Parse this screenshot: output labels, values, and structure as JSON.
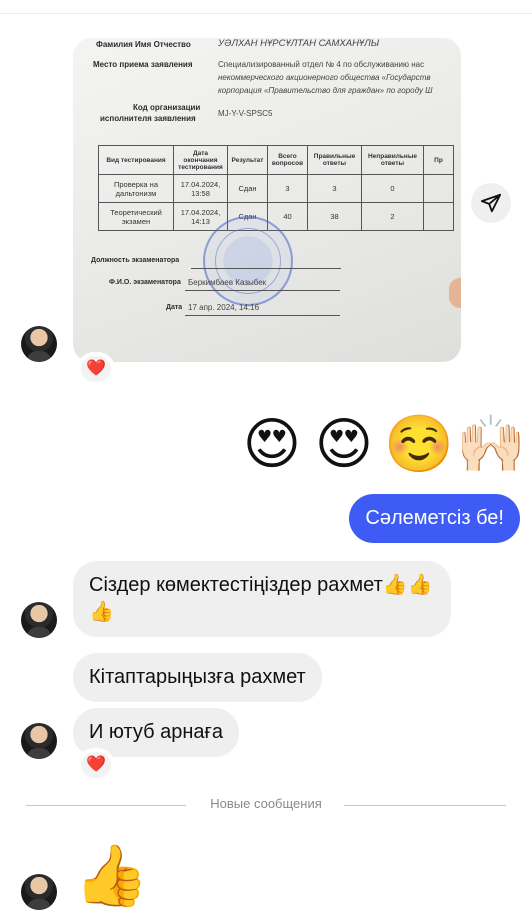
{
  "document_photo": {
    "fields": {
      "fio_label": "Фамилия Имя Отчество",
      "fio_value": "УӘЛХАН НҰРСҰЛТАН САМХАНҰЛЫ",
      "place_label": "Место приема заявления",
      "place_value_1": "Специализированный отдел № 4 по обслуживанию нас",
      "place_value_2": "некоммерческого акционерного общества «Государств",
      "place_value_3": "корпорация «Правительство для граждан» по городу Ш",
      "org_code_label_1": "Код организации",
      "org_code_label_2": "исполнителя заявления",
      "org_code_value": "MJ-Y-V-SPSC5",
      "examiner_title_label": "Должность экзаменатора",
      "examiner_name_label": "Ф.И.О. экзаменатора",
      "examiner_name_value": "Беркимбаев Казыбек",
      "date_label": "Дата",
      "date_value": "17 апр. 2024, 14:16"
    },
    "table": {
      "headers": [
        "Вид тестирования",
        "Дата окончания тестирования",
        "Результат",
        "Всего вопросов",
        "Правильные ответы",
        "Неправильные ответы",
        "Пр"
      ],
      "rows": [
        [
          "Проверка на дальтонизм",
          "17.04.2024, 13:58",
          "Сдан",
          "3",
          "3",
          "0",
          ""
        ],
        [
          "Теоретический экзамен",
          "17.04.2024, 14:13",
          "Сдан",
          "40",
          "38",
          "2",
          ""
        ]
      ]
    },
    "reaction": "❤️"
  },
  "emoji_message": [
    "😍",
    "😍",
    "☺️",
    "🙌🏻"
  ],
  "outgoing_message": "Сәлеметсіз бе!",
  "incoming_messages": [
    "Сіздер көмектестіңіздер рахмет👍👍👍",
    "Кітаптарыңызға рахмет",
    "И ютуб арнаға"
  ],
  "last_reaction": "❤️",
  "divider_label": "Новые сообщения",
  "last_message": "👍",
  "icons": {
    "share": "send-icon",
    "heart": "heart-icon"
  },
  "colors": {
    "outgoing_bubble": "#3e5cf5",
    "incoming_bubble": "#efefef",
    "heart": "#e0245e"
  }
}
